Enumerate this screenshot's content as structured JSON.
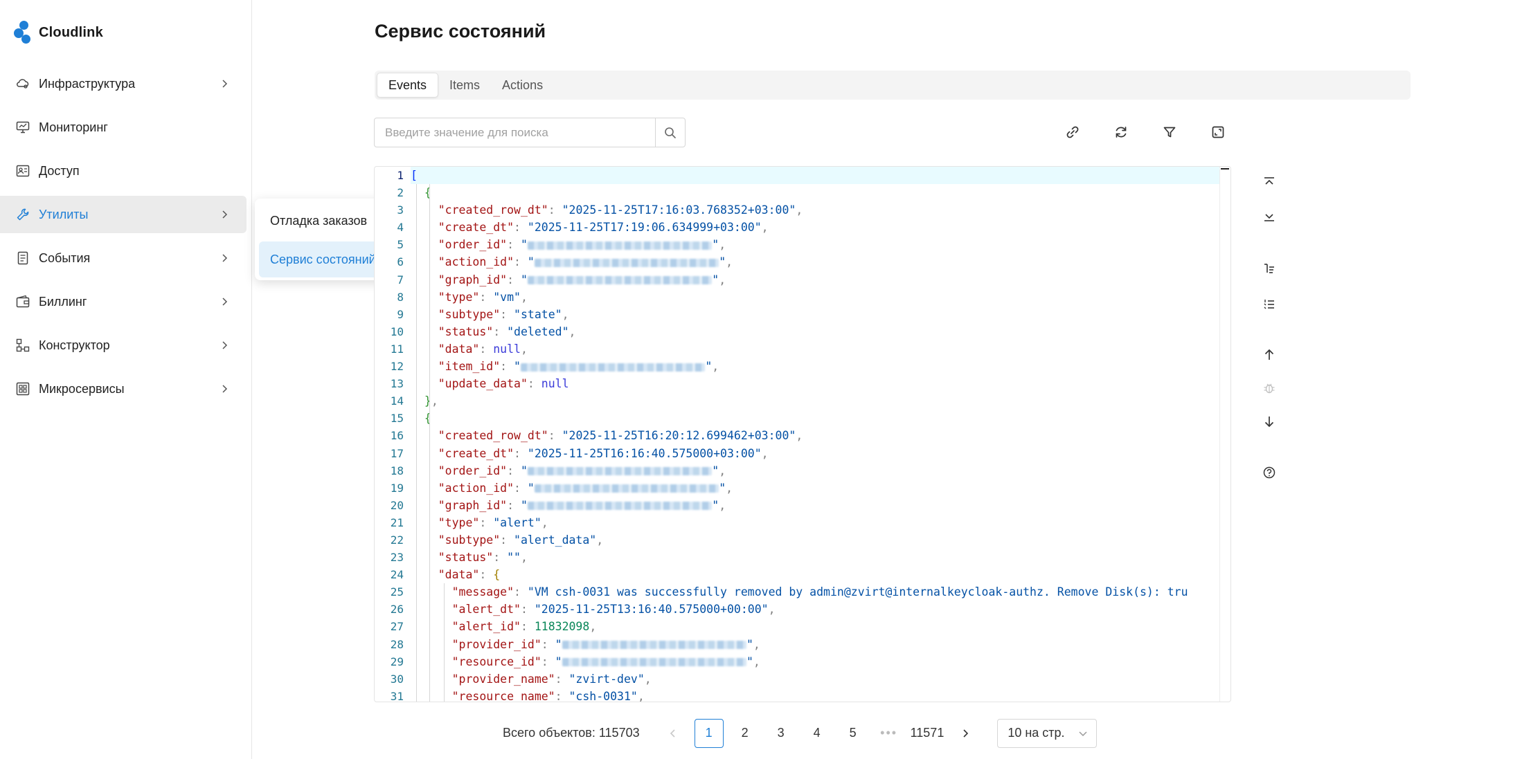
{
  "app": {
    "name": "Cloudlink",
    "brand_color": "#1f7fd6"
  },
  "sidebar": {
    "items": [
      {
        "label": "Инфраструктура",
        "icon": "cloud-settings-icon",
        "has_chevron": true
      },
      {
        "label": "Мониторинг",
        "icon": "monitor-icon",
        "has_chevron": false
      },
      {
        "label": "Доступ",
        "icon": "access-icon",
        "has_chevron": false
      },
      {
        "label": "Утилиты",
        "icon": "tools-icon",
        "has_chevron": true,
        "active": true
      },
      {
        "label": "События",
        "icon": "events-icon",
        "has_chevron": true
      },
      {
        "label": "Биллинг",
        "icon": "wallet-icon",
        "has_chevron": true
      },
      {
        "label": "Конструктор",
        "icon": "constructor-icon",
        "has_chevron": true
      },
      {
        "label": "Микросервисы",
        "icon": "microservices-icon",
        "has_chevron": true
      }
    ]
  },
  "submenu": {
    "items": [
      {
        "label": "Отладка заказов",
        "selected": false
      },
      {
        "label": "Сервис состояний",
        "selected": true
      }
    ]
  },
  "page": {
    "title": "Сервис состояний"
  },
  "tabs": [
    {
      "label": "Events",
      "active": true
    },
    {
      "label": "Items",
      "active": false
    },
    {
      "label": "Actions",
      "active": false
    }
  ],
  "search": {
    "placeholder": "Введите значение для поиска",
    "value": ""
  },
  "toolbar": {
    "icons": [
      "link-icon",
      "refresh-icon",
      "filter-icon",
      "fullscreen-icon"
    ]
  },
  "editor": {
    "lines": [
      [
        [
          "br1",
          "["
        ]
      ],
      [
        [
          "br2",
          "  {"
        ]
      ],
      [
        [
          "p",
          "    "
        ],
        [
          "k",
          "\"created_row_dt\""
        ],
        [
          "p",
          ": "
        ],
        [
          "s",
          "\"2025-11-25T17:16:03.768352+03:00\""
        ],
        [
          "p",
          ","
        ]
      ],
      [
        [
          "p",
          "    "
        ],
        [
          "k",
          "\"create_dt\""
        ],
        [
          "p",
          ": "
        ],
        [
          "s",
          "\"2025-11-25T17:19:06.634999+03:00\""
        ],
        [
          "p",
          ","
        ]
      ],
      [
        [
          "p",
          "    "
        ],
        [
          "k",
          "\"order_id\""
        ],
        [
          "p",
          ": "
        ],
        [
          "s",
          "\""
        ],
        [
          "blur",
          "36"
        ],
        [
          "s",
          "\""
        ],
        [
          "p",
          ","
        ]
      ],
      [
        [
          "p",
          "    "
        ],
        [
          "k",
          "\"action_id\""
        ],
        [
          "p",
          ": "
        ],
        [
          "s",
          "\""
        ],
        [
          "blur",
          "36"
        ],
        [
          "s",
          "\""
        ],
        [
          "p",
          ","
        ]
      ],
      [
        [
          "p",
          "    "
        ],
        [
          "k",
          "\"graph_id\""
        ],
        [
          "p",
          ": "
        ],
        [
          "s",
          "\""
        ],
        [
          "blur",
          "36"
        ],
        [
          "s",
          "\""
        ],
        [
          "p",
          ","
        ]
      ],
      [
        [
          "p",
          "    "
        ],
        [
          "k",
          "\"type\""
        ],
        [
          "p",
          ": "
        ],
        [
          "s",
          "\"vm\""
        ],
        [
          "p",
          ","
        ]
      ],
      [
        [
          "p",
          "    "
        ],
        [
          "k",
          "\"subtype\""
        ],
        [
          "p",
          ": "
        ],
        [
          "s",
          "\"state\""
        ],
        [
          "p",
          ","
        ]
      ],
      [
        [
          "p",
          "    "
        ],
        [
          "k",
          "\"status\""
        ],
        [
          "p",
          ": "
        ],
        [
          "s",
          "\"deleted\""
        ],
        [
          "p",
          ","
        ]
      ],
      [
        [
          "p",
          "    "
        ],
        [
          "k",
          "\"data\""
        ],
        [
          "p",
          ": "
        ],
        [
          "b",
          "null"
        ],
        [
          "p",
          ","
        ]
      ],
      [
        [
          "p",
          "    "
        ],
        [
          "k",
          "\"item_id\""
        ],
        [
          "p",
          ": "
        ],
        [
          "s",
          "\""
        ],
        [
          "blur",
          "36"
        ],
        [
          "s",
          "\""
        ],
        [
          "p",
          ","
        ]
      ],
      [
        [
          "p",
          "    "
        ],
        [
          "k",
          "\"update_data\""
        ],
        [
          "p",
          ": "
        ],
        [
          "b",
          "null"
        ]
      ],
      [
        [
          "br2",
          "  }"
        ],
        [
          "p",
          ","
        ]
      ],
      [
        [
          "br2",
          "  {"
        ]
      ],
      [
        [
          "p",
          "    "
        ],
        [
          "k",
          "\"created_row_dt\""
        ],
        [
          "p",
          ": "
        ],
        [
          "s",
          "\"2025-11-25T16:20:12.699462+03:00\""
        ],
        [
          "p",
          ","
        ]
      ],
      [
        [
          "p",
          "    "
        ],
        [
          "k",
          "\"create_dt\""
        ],
        [
          "p",
          ": "
        ],
        [
          "s",
          "\"2025-11-25T16:16:40.575000+03:00\""
        ],
        [
          "p",
          ","
        ]
      ],
      [
        [
          "p",
          "    "
        ],
        [
          "k",
          "\"order_id\""
        ],
        [
          "p",
          ": "
        ],
        [
          "s",
          "\""
        ],
        [
          "blur",
          "36"
        ],
        [
          "s",
          "\""
        ],
        [
          "p",
          ","
        ]
      ],
      [
        [
          "p",
          "    "
        ],
        [
          "k",
          "\"action_id\""
        ],
        [
          "p",
          ": "
        ],
        [
          "s",
          "\""
        ],
        [
          "blur",
          "36"
        ],
        [
          "s",
          "\""
        ],
        [
          "p",
          ","
        ]
      ],
      [
        [
          "p",
          "    "
        ],
        [
          "k",
          "\"graph_id\""
        ],
        [
          "p",
          ": "
        ],
        [
          "s",
          "\""
        ],
        [
          "blur",
          "36"
        ],
        [
          "s",
          "\""
        ],
        [
          "p",
          ","
        ]
      ],
      [
        [
          "p",
          "    "
        ],
        [
          "k",
          "\"type\""
        ],
        [
          "p",
          ": "
        ],
        [
          "s",
          "\"alert\""
        ],
        [
          "p",
          ","
        ]
      ],
      [
        [
          "p",
          "    "
        ],
        [
          "k",
          "\"subtype\""
        ],
        [
          "p",
          ": "
        ],
        [
          "s",
          "\"alert_data\""
        ],
        [
          "p",
          ","
        ]
      ],
      [
        [
          "p",
          "    "
        ],
        [
          "k",
          "\"status\""
        ],
        [
          "p",
          ": "
        ],
        [
          "s",
          "\"\""
        ],
        [
          "p",
          ","
        ]
      ],
      [
        [
          "p",
          "    "
        ],
        [
          "k",
          "\"data\""
        ],
        [
          "p",
          ": "
        ],
        [
          "br3",
          "{"
        ]
      ],
      [
        [
          "p",
          "      "
        ],
        [
          "k",
          "\"message\""
        ],
        [
          "p",
          ": "
        ],
        [
          "s",
          "\"VM csh-0031 was successfully removed by admin@zvirt@internalkeycloak-authz. Remove Disk(s): tru"
        ]
      ],
      [
        [
          "p",
          "      "
        ],
        [
          "k",
          "\"alert_dt\""
        ],
        [
          "p",
          ": "
        ],
        [
          "s",
          "\"2025-11-25T13:16:40.575000+00:00\""
        ],
        [
          "p",
          ","
        ]
      ],
      [
        [
          "p",
          "      "
        ],
        [
          "k",
          "\"alert_id\""
        ],
        [
          "p",
          ": "
        ],
        [
          "n",
          "11832098"
        ],
        [
          "p",
          ","
        ]
      ],
      [
        [
          "p",
          "      "
        ],
        [
          "k",
          "\"provider_id\""
        ],
        [
          "p",
          ": "
        ],
        [
          "s",
          "\""
        ],
        [
          "blur",
          "36"
        ],
        [
          "s",
          "\""
        ],
        [
          "p",
          ","
        ]
      ],
      [
        [
          "p",
          "      "
        ],
        [
          "k",
          "\"resource_id\""
        ],
        [
          "p",
          ": "
        ],
        [
          "s",
          "\""
        ],
        [
          "blur",
          "36"
        ],
        [
          "s",
          "\""
        ],
        [
          "p",
          ","
        ]
      ],
      [
        [
          "p",
          "      "
        ],
        [
          "k",
          "\"provider_name\""
        ],
        [
          "p",
          ": "
        ],
        [
          "s",
          "\"zvirt-dev\""
        ],
        [
          "p",
          ","
        ]
      ],
      [
        [
          "p",
          "      "
        ],
        [
          "k",
          "\"resource_name\""
        ],
        [
          "p",
          ": "
        ],
        [
          "s",
          "\"csh-0031\""
        ],
        [
          "p",
          ","
        ]
      ]
    ]
  },
  "side_tools": [
    "collapse-all-icon",
    "expand-all-icon",
    "sort-tree-icon",
    "numbered-list-icon",
    "arrow-up-icon",
    "bug-icon",
    "arrow-down-icon",
    "help-icon"
  ],
  "pagination": {
    "total_label": "Всего объектов: 115703",
    "pages": [
      "1",
      "2",
      "3",
      "4",
      "5"
    ],
    "ellipsis": "•••",
    "last_page": "11571",
    "current": "1",
    "page_size": "10 на стр."
  }
}
